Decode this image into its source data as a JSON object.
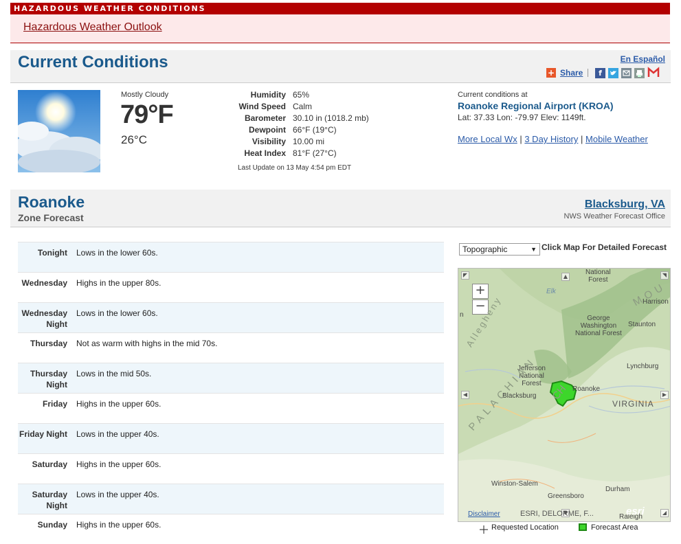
{
  "hazard": {
    "bar_title": "HAZARDOUS WEATHER CONDITIONS",
    "outlook_link": "Hazardous Weather Outlook"
  },
  "current": {
    "title": "Current Conditions",
    "espanol": "En Español",
    "share": "Share",
    "sky": "Mostly Cloudy",
    "temp_f": "79°F",
    "temp_c": "26°C",
    "details": [
      {
        "label": "Humidity",
        "value": "65%"
      },
      {
        "label": "Wind Speed",
        "value": "Calm"
      },
      {
        "label": "Barometer",
        "value": "30.10 in (1018.2 mb)"
      },
      {
        "label": "Dewpoint",
        "value": "66°F (19°C)"
      },
      {
        "label": "Visibility",
        "value": "10.00 mi"
      },
      {
        "label": "Heat Index",
        "value": "81°F (27°C)"
      }
    ],
    "last_update": "Last Update on 13 May 4:54 pm EDT",
    "station_label": "Current conditions at",
    "station_name": "Roanoke Regional Airport (KROA)",
    "station_coords": "Lat: 37.33 Lon: -79.97 Elev: 1149ft.",
    "links": {
      "local": "More Local Wx",
      "history": "3 Day History",
      "mobile": "Mobile Weather",
      "sep": "|"
    }
  },
  "zone": {
    "title": "Roanoke",
    "subtitle": "Zone Forecast",
    "office_link": "Blacksburg, VA",
    "office_label": "NWS Weather Forecast Office",
    "periods": [
      {
        "period": "Tonight",
        "text": "Lows in the lower 60s."
      },
      {
        "period": "Wednesday",
        "text": "Highs in the upper 80s."
      },
      {
        "period": "Wednesday Night",
        "text": "Lows in the lower 60s."
      },
      {
        "period": "Thursday",
        "text": "Not as warm with highs in the mid 70s."
      },
      {
        "period": "Thursday Night",
        "text": "Lows in the mid 50s."
      },
      {
        "period": "Friday",
        "text": "Highs in the upper 60s."
      },
      {
        "period": "Friday Night",
        "text": "Lows in the upper 40s."
      },
      {
        "period": "Saturday",
        "text": "Highs in the upper 60s."
      },
      {
        "period": "Saturday Night",
        "text": "Lows in the upper 40s."
      },
      {
        "period": "Sunday",
        "text": "Highs in the upper 60s."
      }
    ]
  },
  "map": {
    "layer_select": "Topographic",
    "click_hint": "Click Map For Detailed Forecast",
    "zoom_in": "+",
    "zoom_out": "−",
    "labels": {
      "national_forest_top": "National\nForest",
      "harrison": "Harrison",
      "george_washington": "George\nWashington\nNational Forest",
      "staunton": "Staunton",
      "jefferson": "Jefferson\nNational\nForest",
      "lynchburg": "Lynchburg",
      "roanoke": "Roanoke",
      "blacksburg": "Blacksburg",
      "virginia": "VIRGINIA",
      "winston_salem": "Winston-Salem",
      "greensboro": "Greensboro",
      "durham": "Durham",
      "raleigh": "Raleigh",
      "palachian": "PALACHIAN",
      "mou": "MOU",
      "ch": "CH",
      "allegheny": "Allegheny",
      "n": "n",
      "elk": "Elk"
    },
    "disclaimer": "Disclaimer",
    "attribution": "ESRI, DELORME, F...",
    "esri": "esri",
    "legend_requested": "Requested Location",
    "legend_area": "Forecast Area",
    "colors": {
      "forecast_area": "#3dd62b",
      "forecast_border": "#1e8a14"
    }
  }
}
